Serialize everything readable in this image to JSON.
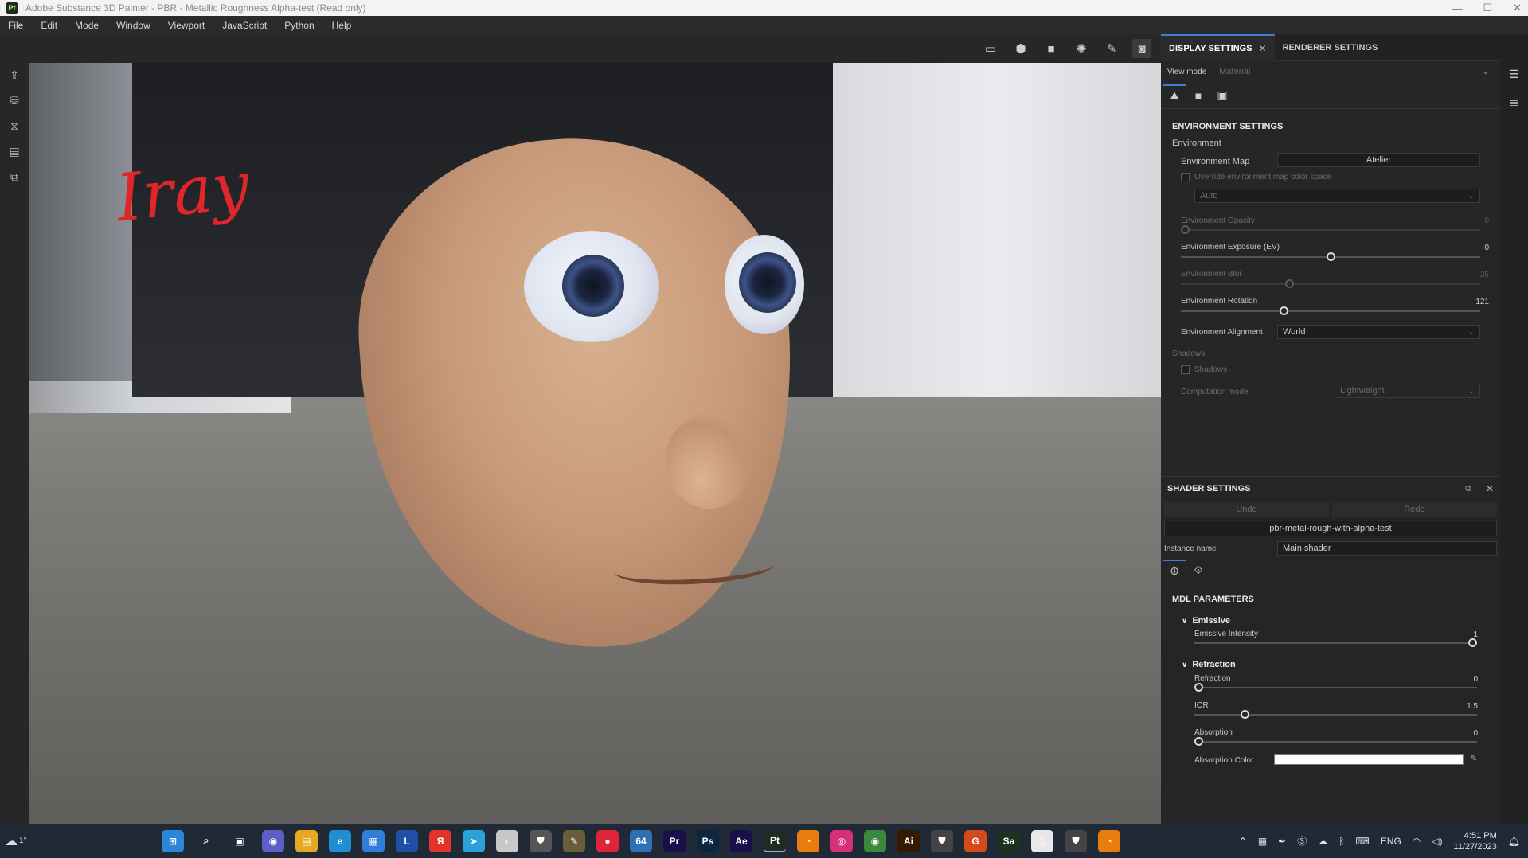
{
  "window": {
    "title": "Adobe Substance 3D Painter - PBR - Metallic Roughness Alpha-test (Read only)",
    "logo_text": "Pt"
  },
  "menu": [
    "File",
    "Edit",
    "Mode",
    "Window",
    "Viewport",
    "JavaScript",
    "Python",
    "Help"
  ],
  "viewport": {
    "annotation": "Iray"
  },
  "display_settings": {
    "tabs": {
      "display": "DISPLAY SETTINGS",
      "renderer": "RENDERER SETTINGS"
    },
    "view_mode_label": "View mode",
    "view_mode_value": "Material",
    "env_section": "ENVIRONMENT SETTINGS",
    "environment_label": "Environment",
    "env_map_label": "Environment Map",
    "env_map_value": "Atelier",
    "override_label": "Override environment map color space",
    "color_space_value": "Auto",
    "opacity": {
      "label": "Environment Opacity",
      "value": "0",
      "fraction": 0.0
    },
    "exposure": {
      "label": "Environment Exposure (EV)",
      "value": "0",
      "fraction": 0.5
    },
    "blur": {
      "label": "Environment Blur",
      "value": "35",
      "fraction": 0.36
    },
    "rotation": {
      "label": "Environment Rotation",
      "value": "121",
      "fraction": 0.34
    },
    "alignment_label": "Environment Alignment",
    "alignment_value": "World",
    "shadows_section": "Shadows",
    "shadows_check": "Shadows",
    "computation_label": "Computation mode",
    "computation_value": "Lightweight"
  },
  "shader_settings": {
    "title": "SHADER SETTINGS",
    "undo": "Undo",
    "redo": "Redo",
    "shader_name": "pbr-metal-rough-with-alpha-test",
    "instance_label": "Instance name",
    "instance_value": "Main shader",
    "mdl_title": "MDL PARAMETERS",
    "emissive_group": "Emissive",
    "emissive_intensity": {
      "label": "Emissive Intensity",
      "value": "1",
      "fraction": 1.0
    },
    "refraction_group": "Refraction",
    "refraction": {
      "label": "Refraction",
      "value": "0",
      "fraction": 0.0
    },
    "ior": {
      "label": "IOR",
      "value": "1.5",
      "fraction": 0.17
    },
    "absorption": {
      "label": "Absorption",
      "value": "0",
      "fraction": 0.0
    },
    "absorption_color_label": "Absorption Color"
  },
  "taskbar": {
    "apps": [
      {
        "name": "windows-start",
        "glyph": "⊞",
        "color": "#2b86d6"
      },
      {
        "name": "search",
        "glyph": "⌕",
        "color": "transparent"
      },
      {
        "name": "task-view",
        "glyph": "▣",
        "color": "transparent"
      },
      {
        "name": "teams",
        "glyph": "◉",
        "color": "#5b5fc7"
      },
      {
        "name": "explorer",
        "glyph": "▤",
        "color": "#e6a823"
      },
      {
        "name": "edge",
        "glyph": "e",
        "color": "#1f8fcf"
      },
      {
        "name": "store",
        "glyph": "▦",
        "color": "#2f7fd8"
      },
      {
        "name": "l-app",
        "glyph": "L",
        "color": "#1f4fa8"
      },
      {
        "name": "yandex",
        "glyph": "Я",
        "color": "#e2322a"
      },
      {
        "name": "telegram",
        "glyph": "➤",
        "color": "#2aa1d8"
      },
      {
        "name": "app-1",
        "glyph": "◐",
        "color": "#c8c8c8"
      },
      {
        "name": "app-2",
        "glyph": "⛊",
        "color": "#555"
      },
      {
        "name": "app-3",
        "glyph": "✎",
        "color": "#6b5c3a"
      },
      {
        "name": "app-4",
        "glyph": "●",
        "color": "#e0243c"
      },
      {
        "name": "app-5",
        "glyph": "64",
        "color": "#2f6fb5"
      },
      {
        "name": "premiere",
        "glyph": "Pr",
        "color": "#1b0f4a"
      },
      {
        "name": "photoshop",
        "glyph": "Ps",
        "color": "#0c2640"
      },
      {
        "name": "after-effects",
        "glyph": "Ae",
        "color": "#1b0f4a"
      },
      {
        "name": "painter",
        "glyph": "Pt",
        "color": "#1f2d20"
      },
      {
        "name": "blender",
        "glyph": "◔",
        "color": "#e87d0d"
      },
      {
        "name": "instagram",
        "glyph": "◎",
        "color": "#d6307a"
      },
      {
        "name": "chrome",
        "glyph": "◉",
        "color": "#3a8a3e"
      },
      {
        "name": "illustrator",
        "glyph": "Ai",
        "color": "#331a00"
      },
      {
        "name": "app-6",
        "glyph": "⛊",
        "color": "#444"
      },
      {
        "name": "app-7",
        "glyph": "G",
        "color": "#d44a1a"
      },
      {
        "name": "substance-sampler",
        "glyph": "Sa",
        "color": "#1d3320"
      },
      {
        "name": "notepad",
        "glyph": "▯",
        "color": "#e8e8e8"
      },
      {
        "name": "app-8",
        "glyph": "⛊",
        "color": "#444"
      },
      {
        "name": "blender-2",
        "glyph": "◔",
        "color": "#e87d0d"
      }
    ],
    "lang": "ENG",
    "time": "4:51 PM",
    "date": "11/27/2023",
    "weather_temp": "1°"
  }
}
